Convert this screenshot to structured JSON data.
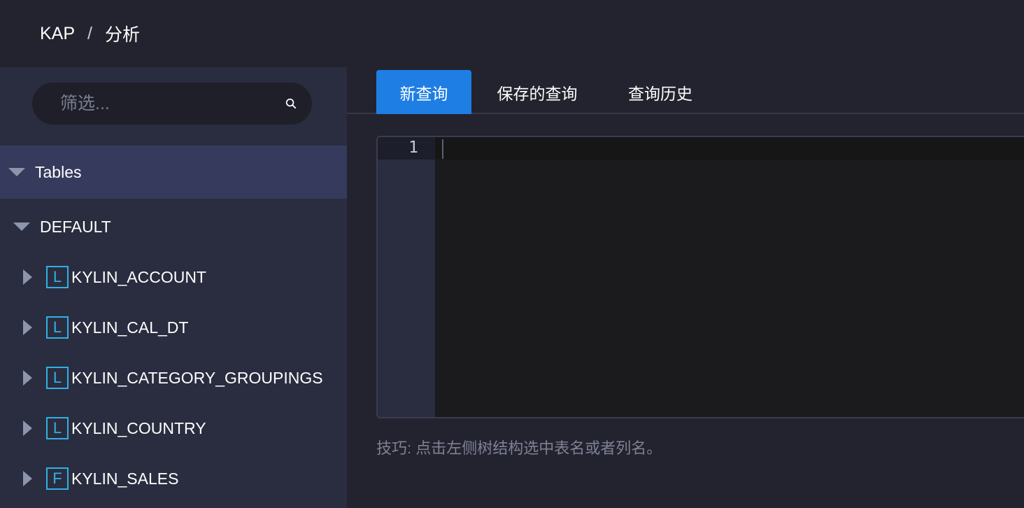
{
  "breadcrumb": {
    "root": "KAP",
    "separator": "/",
    "current": "分析"
  },
  "sidebar": {
    "search": {
      "placeholder": "筛选...",
      "value": ""
    },
    "tables_label": "Tables",
    "database": "DEFAULT",
    "tables": [
      {
        "badge": "L",
        "name": "KYLIN_ACCOUNT"
      },
      {
        "badge": "L",
        "name": "KYLIN_CAL_DT"
      },
      {
        "badge": "L",
        "name": "KYLIN_CATEGORY_GROUPINGS"
      },
      {
        "badge": "L",
        "name": "KYLIN_COUNTRY"
      },
      {
        "badge": "F",
        "name": "KYLIN_SALES"
      }
    ]
  },
  "main": {
    "tabs": [
      {
        "label": "新查询",
        "active": true
      },
      {
        "label": "保存的查询",
        "active": false
      },
      {
        "label": "查询历史",
        "active": false
      }
    ],
    "editor": {
      "line_number": "1",
      "content": ""
    },
    "tip": "技巧: 点击左侧树结构选中表名或者列名。"
  },
  "colors": {
    "accent": "#1f7ee3",
    "badge": "#2fb1e6",
    "sidebar_bg": "#2a2d3f",
    "selected_row": "#363a5c",
    "page_bg": "#22232e"
  },
  "icons": {
    "search": "search-icon"
  }
}
